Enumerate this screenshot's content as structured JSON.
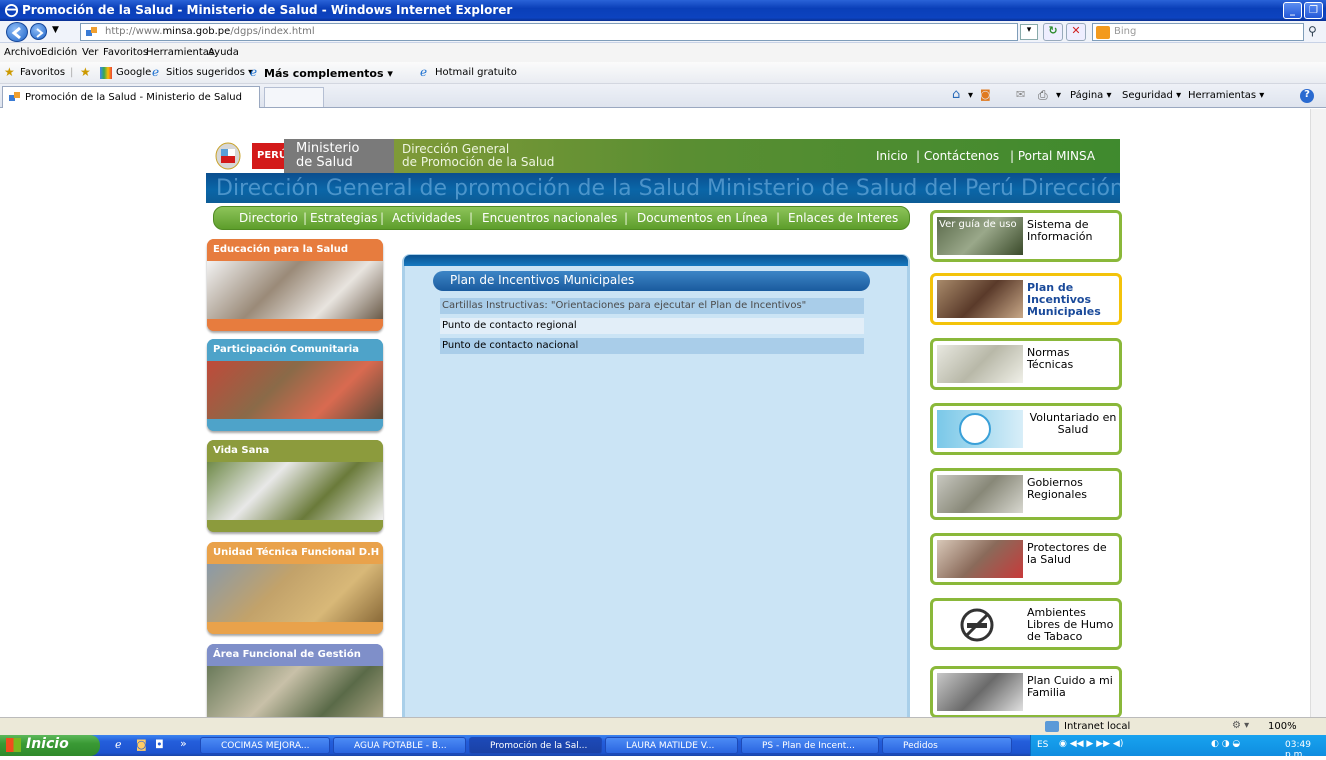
{
  "window": {
    "title": "Promoción de la Salud - Ministerio de Salud - Windows Internet Explorer"
  },
  "address": {
    "url_prefix": "http://www.",
    "url_domain": "minsa.gob.pe",
    "url_path": "/dgps/index.html",
    "search_placeholder": "Bing"
  },
  "menu": [
    "Archivo",
    "Edición",
    "Ver",
    "Favoritos",
    "Herramientas",
    "Ayuda"
  ],
  "favorites": {
    "label": "Favoritos",
    "items": [
      "Google",
      "Sitios sugeridos ▾",
      "Más complementos ▾",
      "Hotmail gratuito"
    ]
  },
  "tab": {
    "title": "Promoción de la Salud - Ministerio de Salud"
  },
  "commands": [
    "Página ▾",
    "Seguridad ▾",
    "Herramientas ▾"
  ],
  "site": {
    "peru": "PERÚ",
    "ministerio_1": "Ministerio",
    "ministerio_2": "de Salud",
    "dg_1": "Dirección General",
    "dg_2": "de Promoción de la Salud",
    "top_links": [
      "Inicio",
      "| Contáctenos",
      "| Portal MINSA"
    ],
    "banner": "Dirección General de promoción de la Salud  Ministerio de Salud del Perú   Dirección General de pr",
    "nav": [
      "Directorio",
      "Estrategias",
      "Actividades",
      "Encuentros nacionales",
      "Documentos en Línea",
      "Enlaces de Interes"
    ],
    "left_boxes": [
      {
        "title": "Educación para la Salud",
        "color": "#e77c3e"
      },
      {
        "title": "Participación Comunitaria",
        "color": "#4ea3c9"
      },
      {
        "title": "Vida Sana",
        "color": "#8c9b3d"
      },
      {
        "title": "Unidad Técnica Funcional D.H",
        "color": "#e9a24b"
      },
      {
        "title": "Área Funcional de Gestión",
        "color": "#7f8fc9"
      }
    ],
    "center": {
      "title": "Plan de Incentivos Municipales",
      "rows": [
        "Cartillas Instructivas: \"Orientaciones para ejecutar el Plan de Incentivos\"",
        "Punto de contacto regional",
        "Punto de contacto nacional"
      ]
    },
    "right_buttons": [
      {
        "label": "Sistema de Información",
        "overlay": "Ver guía de uso"
      },
      {
        "label": "Plan de Incentivos Municipales"
      },
      {
        "label": "Normas Técnicas"
      },
      {
        "label": "Voluntariado en Salud"
      },
      {
        "label": "Gobiernos Regionales"
      },
      {
        "label": "Protectores de la Salud"
      },
      {
        "label": "Ambientes Libres de Humo de Tabaco"
      },
      {
        "label": "Plan Cuido a mi Familia"
      }
    ]
  },
  "status": {
    "zone": "Intranet local",
    "zoom": "100%"
  },
  "taskbar": {
    "start": "Inicio",
    "tasks": [
      "COCIMAS MEJORA...",
      "AGUA POTABLE - B...",
      "Promoción de la Sal...",
      "LAURA MATILDE V...",
      "PS - Plan de Incent...",
      "Pedidos"
    ],
    "lang": "ES",
    "clock": "03:49 p.m."
  }
}
